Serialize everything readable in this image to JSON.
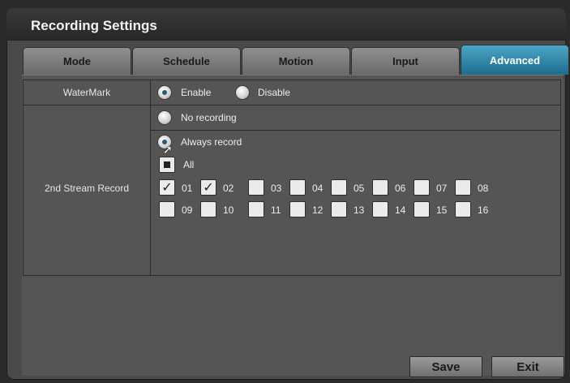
{
  "window": {
    "title": "Recording Settings"
  },
  "tabs": [
    {
      "label": "Mode",
      "active": false
    },
    {
      "label": "Schedule",
      "active": false
    },
    {
      "label": "Motion",
      "active": false
    },
    {
      "label": "Input",
      "active": false
    },
    {
      "label": "Advanced",
      "active": true
    }
  ],
  "watermark": {
    "label": "WaterMark",
    "options": [
      {
        "label": "Enable",
        "selected": true
      },
      {
        "label": "Disable",
        "selected": false
      }
    ]
  },
  "second_stream": {
    "label": "2nd Stream Record",
    "no_recording_label": "No recording",
    "always_record_label": "Always record",
    "mode": "Always record",
    "all_label": "All",
    "channels": [
      {
        "label": "01",
        "checked": true
      },
      {
        "label": "02",
        "checked": true
      },
      {
        "label": "03",
        "checked": false
      },
      {
        "label": "04",
        "checked": false
      },
      {
        "label": "05",
        "checked": false
      },
      {
        "label": "06",
        "checked": false
      },
      {
        "label": "07",
        "checked": false
      },
      {
        "label": "08",
        "checked": false
      },
      {
        "label": "09",
        "checked": false
      },
      {
        "label": "10",
        "checked": false
      },
      {
        "label": "11",
        "checked": false
      },
      {
        "label": "12",
        "checked": false
      },
      {
        "label": "13",
        "checked": false
      },
      {
        "label": "14",
        "checked": false
      },
      {
        "label": "15",
        "checked": false
      },
      {
        "label": "16",
        "checked": false
      }
    ]
  },
  "buttons": {
    "save": "Save",
    "exit": "Exit"
  },
  "colors": {
    "accent": "#2f86a8",
    "panel": "#555555",
    "tab": "#7d7d7d"
  },
  "icons": {
    "cursor": "mouse-pointer-icon",
    "check": "checkmark-icon"
  }
}
